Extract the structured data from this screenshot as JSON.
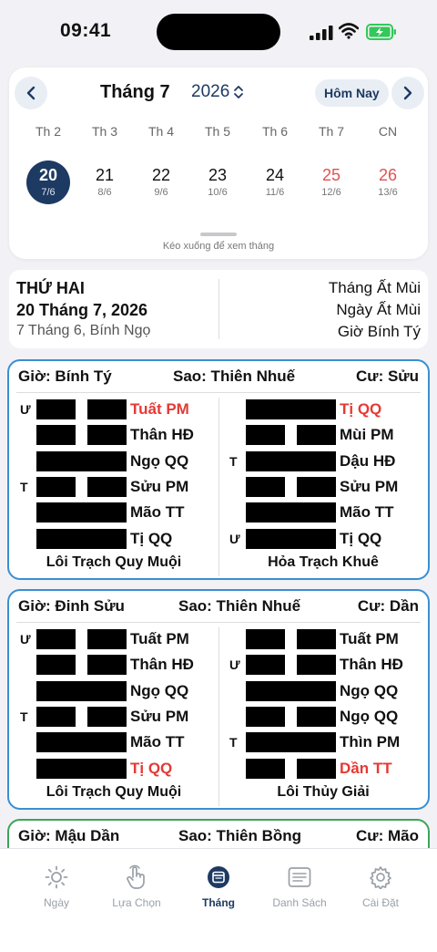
{
  "status": {
    "time": "09:41"
  },
  "calendar": {
    "month": "Tháng 7",
    "year": "2026",
    "today_label": "Hôm Nay",
    "weekdays": [
      "Th 2",
      "Th 3",
      "Th 4",
      "Th 5",
      "Th 6",
      "Th 7",
      "CN"
    ],
    "days": [
      {
        "d": "20",
        "l": "7/6"
      },
      {
        "d": "21",
        "l": "8/6"
      },
      {
        "d": "22",
        "l": "9/6"
      },
      {
        "d": "23",
        "l": "10/6"
      },
      {
        "d": "24",
        "l": "11/6"
      },
      {
        "d": "25",
        "l": "12/6"
      },
      {
        "d": "26",
        "l": "13/6"
      }
    ],
    "hint": "Kéo xuống để xem tháng"
  },
  "info": {
    "weekday": "THỨ HAI",
    "date": "20 Tháng 7, 2026",
    "lunar": "7 Tháng 6, Bính Ngọ",
    "month_cc": "Tháng Ất Mùi",
    "day_cc": "Ngày Ất Mùi",
    "hour_cc": "Giờ Bính Tý"
  },
  "cards": [
    {
      "gio": "Giờ: Bính Tý",
      "sao": "Sao: Thiên Nhuế",
      "cu": "Cư: Sửu",
      "left": {
        "name": "Lôi Trạch Quy Muội",
        "lines": [
          {
            "m": "Ư",
            "t": "Tuất PM",
            "red": true,
            "split": true
          },
          {
            "m": "",
            "t": "Thân HĐ",
            "red": false,
            "split": true
          },
          {
            "m": "",
            "t": "Ngọ QQ",
            "red": false,
            "split": false
          },
          {
            "m": "T",
            "t": "Sửu PM",
            "red": false,
            "split": true
          },
          {
            "m": "",
            "t": "Mão TT",
            "red": false,
            "split": false
          },
          {
            "m": "",
            "t": "Tị QQ",
            "red": false,
            "split": false
          }
        ]
      },
      "right": {
        "name": "Hỏa Trạch Khuê",
        "lines": [
          {
            "m": "",
            "t": "Tị QQ",
            "red": true,
            "split": false
          },
          {
            "m": "",
            "t": "Mùi PM",
            "red": false,
            "split": true
          },
          {
            "m": "T",
            "t": "Dậu HĐ",
            "red": false,
            "split": false
          },
          {
            "m": "",
            "t": "Sửu PM",
            "red": false,
            "split": true
          },
          {
            "m": "",
            "t": "Mão TT",
            "red": false,
            "split": false
          },
          {
            "m": "Ư",
            "t": "Tị QQ",
            "red": false,
            "split": false
          }
        ]
      }
    },
    {
      "gio": "Giờ: Đinh Sửu",
      "sao": "Sao: Thiên Nhuế",
      "cu": "Cư: Dần",
      "left": {
        "name": "Lôi Trạch Quy Muội",
        "lines": [
          {
            "m": "Ư",
            "t": "Tuất PM",
            "red": false,
            "split": true
          },
          {
            "m": "",
            "t": "Thân HĐ",
            "red": false,
            "split": true
          },
          {
            "m": "",
            "t": "Ngọ QQ",
            "red": false,
            "split": false
          },
          {
            "m": "T",
            "t": "Sửu PM",
            "red": false,
            "split": true
          },
          {
            "m": "",
            "t": "Mão TT",
            "red": false,
            "split": false
          },
          {
            "m": "",
            "t": "Tị QQ",
            "red": true,
            "split": false
          }
        ]
      },
      "right": {
        "name": "Lôi Thủy Giải",
        "lines": [
          {
            "m": "",
            "t": "Tuất PM",
            "red": false,
            "split": true
          },
          {
            "m": "Ư",
            "t": "Thân HĐ",
            "red": false,
            "split": true
          },
          {
            "m": "",
            "t": "Ngọ QQ",
            "red": false,
            "split": false
          },
          {
            "m": "",
            "t": "Ngọ QQ",
            "red": false,
            "split": true
          },
          {
            "m": "T",
            "t": "Thìn PM",
            "red": false,
            "split": false
          },
          {
            "m": "",
            "t": "Dần TT",
            "red": true,
            "split": true
          }
        ]
      }
    },
    {
      "gio": "Giờ: Mậu Dần",
      "sao": "Sao: Thiên Bồng",
      "cu": "Cư: Mão"
    }
  ],
  "tabs": [
    {
      "label": "Ngày",
      "icon": "sun-icon"
    },
    {
      "label": "Lựa Chọn",
      "icon": "tap-hand-icon"
    },
    {
      "label": "Tháng",
      "icon": "calendar-icon"
    },
    {
      "label": "Danh Sách",
      "icon": "list-icon"
    },
    {
      "label": "Cài Đặt",
      "icon": "gear-icon"
    }
  ],
  "colors": {
    "accent": "#1d3a63",
    "weekend": "#e05252",
    "card_border": "#3a8fd1",
    "card_border_next": "#3da35a",
    "red_text": "#e53935"
  }
}
